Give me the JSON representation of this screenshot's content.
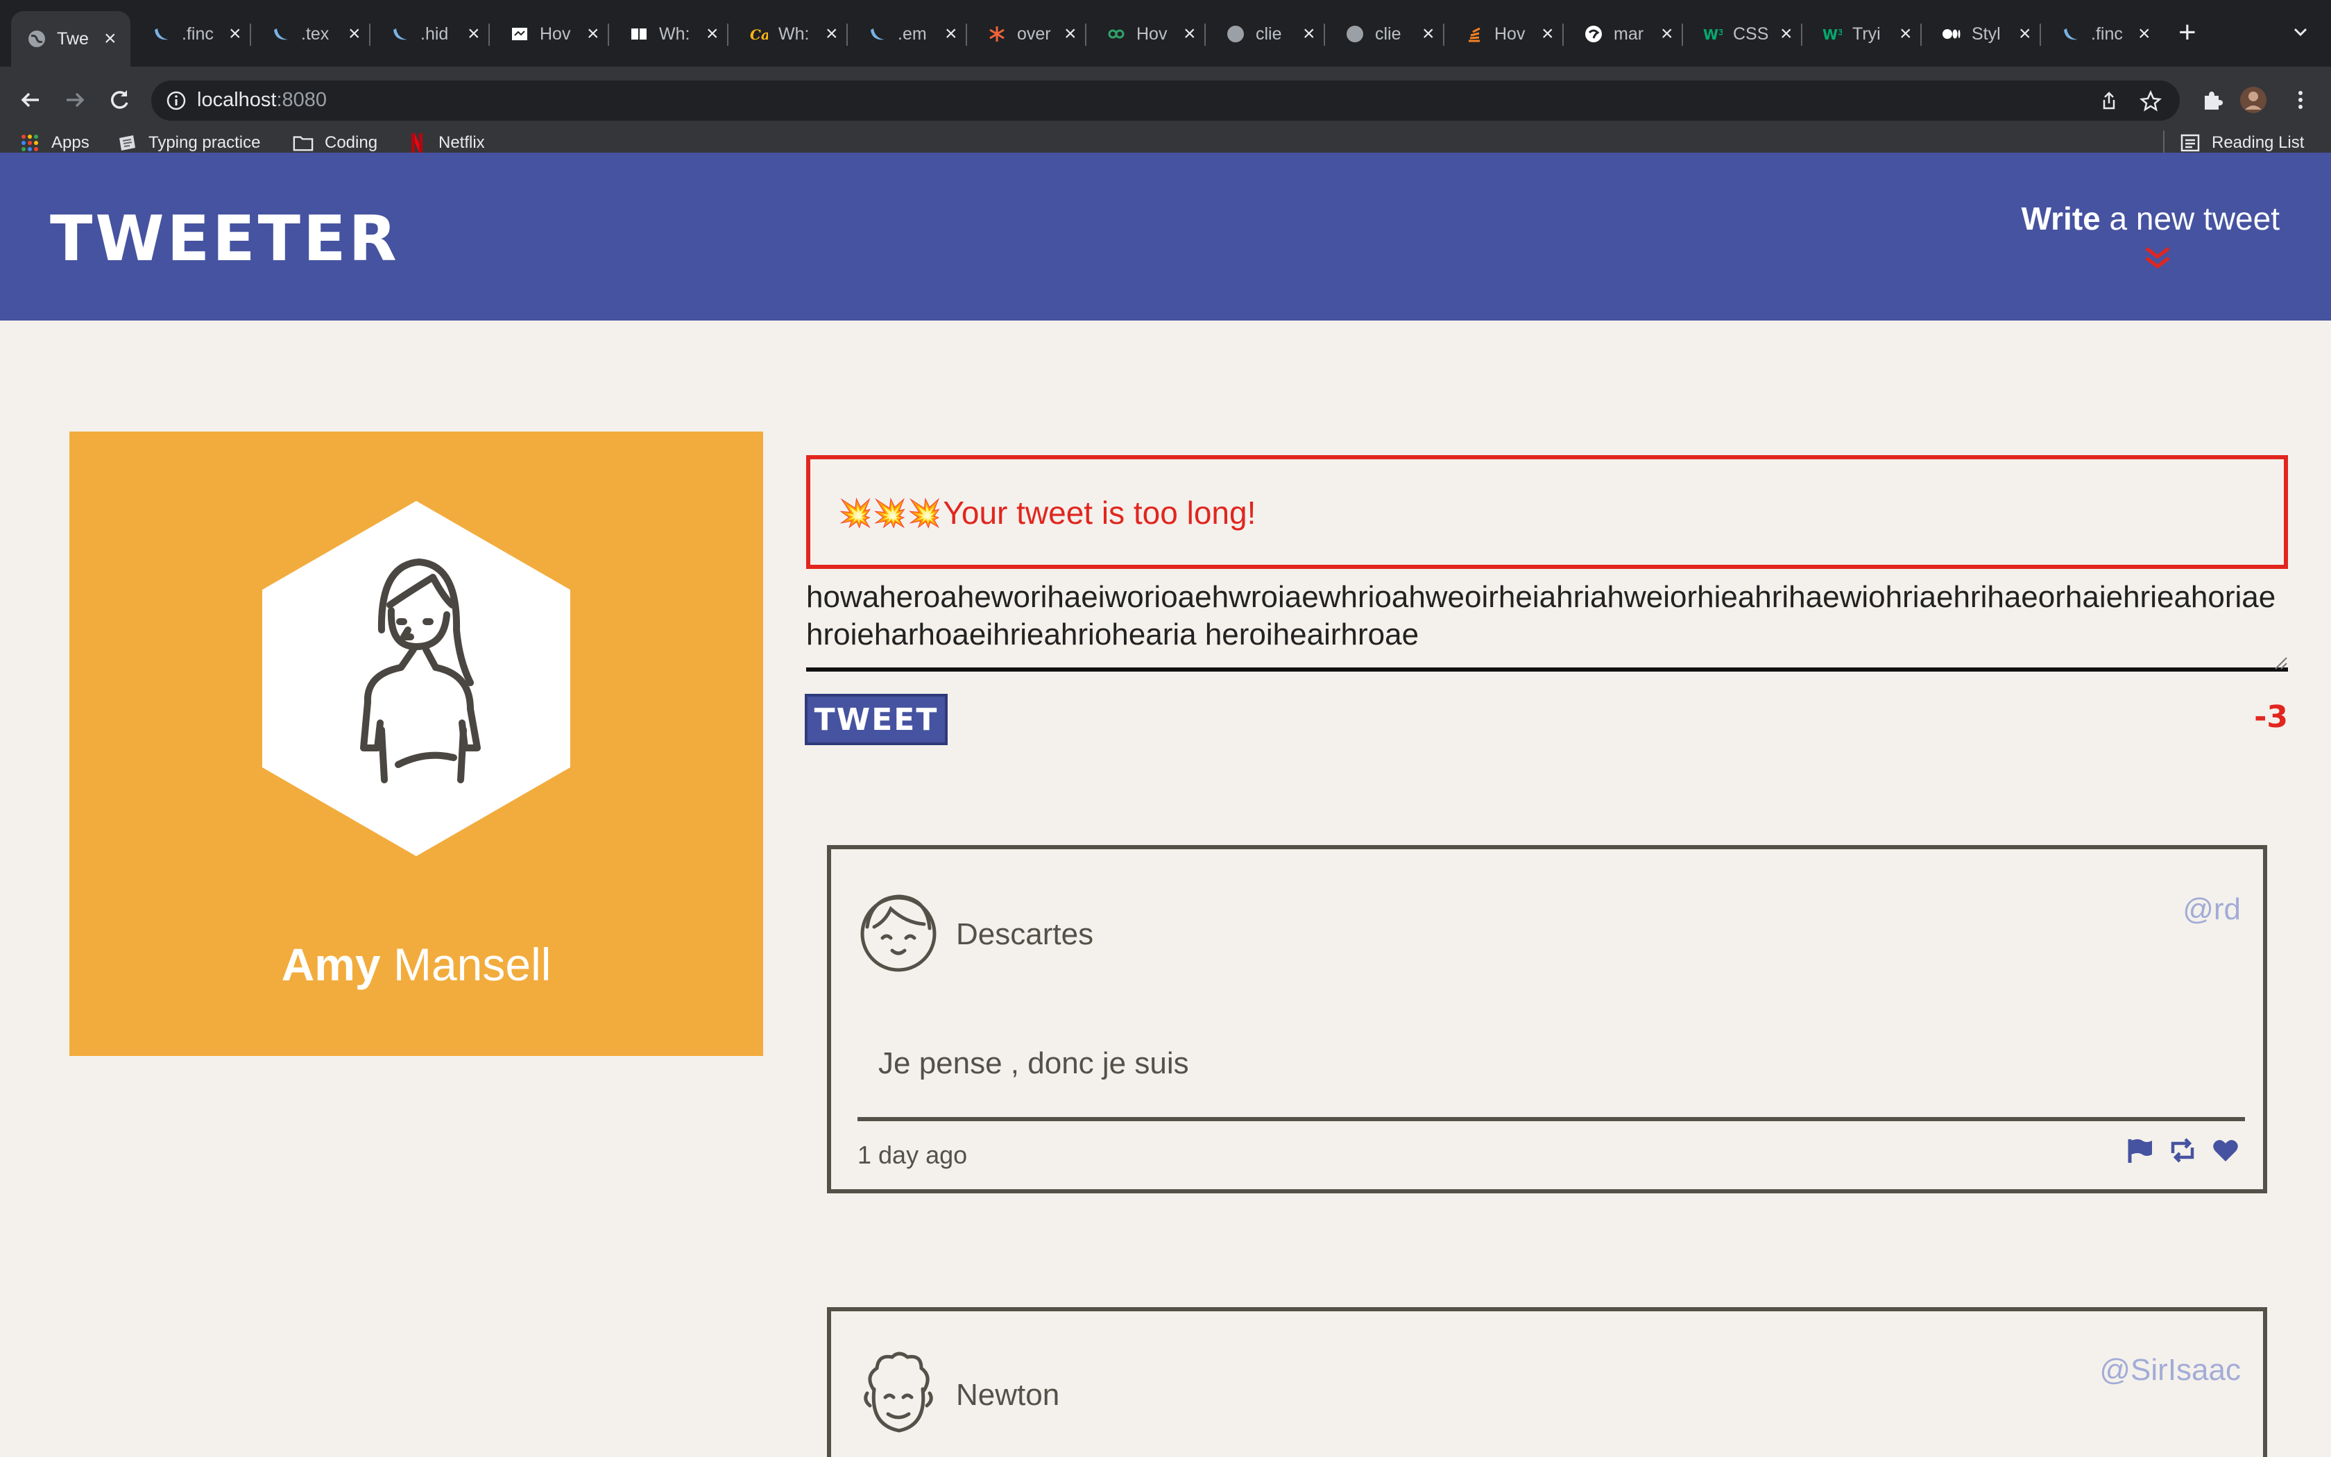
{
  "browser": {
    "tabs": [
      {
        "title": "Twe",
        "icon": "globe-icon",
        "active": true
      },
      {
        "title": ".finc",
        "icon": "jquery-icon"
      },
      {
        "title": ".tex",
        "icon": "jquery-icon"
      },
      {
        "title": ".hid",
        "icon": "jquery-icon"
      },
      {
        "title": "Hov",
        "icon": "site-icon"
      },
      {
        "title": "Wh:",
        "icon": "book-icon"
      },
      {
        "title": "Wh:",
        "icon": "cal-icon"
      },
      {
        "title": ".em",
        "icon": "jquery-icon"
      },
      {
        "title": "over",
        "icon": "asterisk-icon"
      },
      {
        "title": "Hov",
        "icon": "link-icon"
      },
      {
        "title": "clie",
        "icon": "globe-icon"
      },
      {
        "title": "clie",
        "icon": "globe-icon"
      },
      {
        "title": "Hov",
        "icon": "stack-icon"
      },
      {
        "title": "mar",
        "icon": "brain-icon"
      },
      {
        "title": "CSS",
        "icon": "w3-icon"
      },
      {
        "title": "Tryi",
        "icon": "w3-icon"
      },
      {
        "title": "Styl",
        "icon": "medium-icon"
      },
      {
        "title": ".finc",
        "icon": "jquery-icon"
      }
    ],
    "url_host": "localhost",
    "url_port": ":8080",
    "bookmarks": [
      {
        "label": "Apps"
      },
      {
        "label": "Typing practice"
      },
      {
        "label": "Coding"
      },
      {
        "label": "Netflix"
      }
    ],
    "reading_list": "Reading List"
  },
  "header": {
    "logo": "TWEETER",
    "compose_bold": "Write",
    "compose_rest": " a new tweet"
  },
  "profile": {
    "first_name": "Amy",
    "last_name": " Mansell"
  },
  "compose": {
    "error_icons": "💥💥💥",
    "error_message": "Your tweet is too long!",
    "input_value": "howaheroaheworihaeiworioaehwroiaewhrioahweoirheiahriahweiorhieahrihaewiohriaehrihaeorhaiehrieahoriaehroieharhoaeihrieahriohearia heroiheairhroae",
    "button_label": "TWEET",
    "counter": "-3"
  },
  "tweets": [
    {
      "name": "Descartes",
      "handle": "@rd",
      "content": "Je pense , donc je suis",
      "time": "1 day ago"
    },
    {
      "name": "Newton",
      "handle": "@SirIsaac"
    }
  ],
  "colors": {
    "header": "#4653a0",
    "accent": "#e1261f",
    "profile": "#f2ac3d",
    "background": "#f4f1ec"
  }
}
